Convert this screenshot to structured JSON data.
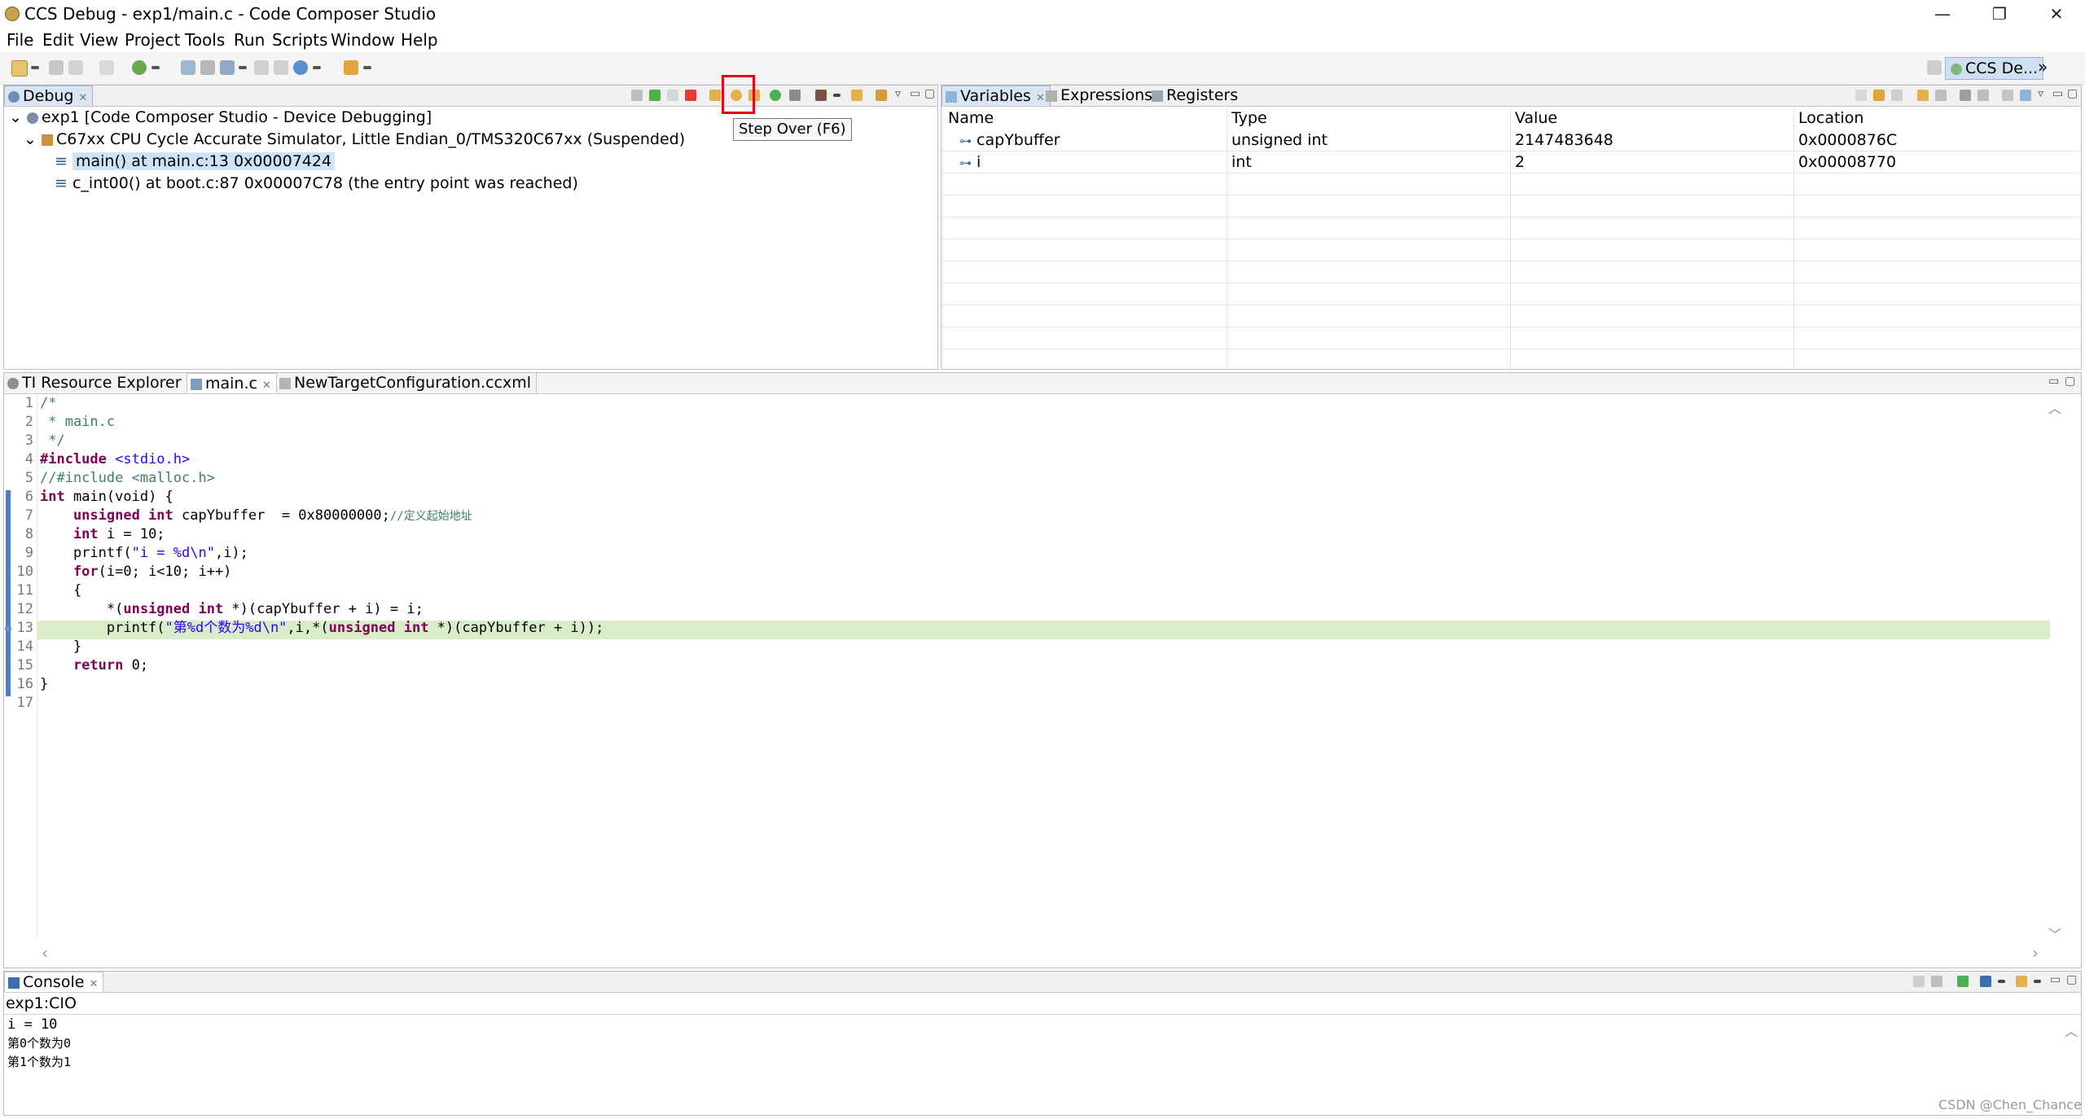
{
  "window": {
    "title": "CCS Debug - exp1/main.c - Code Composer Studio",
    "controls": {
      "minimize": "—",
      "maximize": "❐",
      "close": "✕"
    }
  },
  "menu": [
    "File",
    "Edit",
    "View",
    "Project",
    "Tools",
    "Run",
    "Scripts",
    "Window",
    "Help"
  ],
  "toolbar": {
    "perspective_label": "CCS De...",
    "overflow": "»"
  },
  "debug_view": {
    "tab_label": "Debug",
    "tree": [
      {
        "text": "exp1 [Code Composer Studio - Device Debugging]",
        "expander": "⌄"
      },
      {
        "text": "C67xx CPU Cycle Accurate Simulator, Little Endian_0/TMS320C67xx (Suspended)",
        "expander": "⌄"
      },
      {
        "text": "main() at main.c:13 0x00007424",
        "icon": "≡"
      },
      {
        "text": "c_int00() at boot.c:87 0x00007C78  (the entry point was reached)",
        "icon": "≡"
      }
    ],
    "tooltip": "Step Over (F6)"
  },
  "variables_view": {
    "tabs": [
      "Variables",
      "Expressions",
      "Registers"
    ],
    "columns": [
      "Name",
      "Type",
      "Value",
      "Location"
    ],
    "rows": [
      {
        "name": "capYbuffer",
        "type": "unsigned int",
        "value": "2147483648",
        "location": "0x0000876C"
      },
      {
        "name": "i",
        "type": "int",
        "value": "2",
        "location": "0x00008770"
      }
    ],
    "row_icon": "⊶"
  },
  "editor": {
    "tabs": [
      "TI Resource Explorer",
      "main.c",
      "NewTargetConfiguration.ccxml"
    ],
    "line_numbers": [
      "1",
      "2",
      "3",
      "4",
      "5",
      "6",
      "7",
      "8",
      "9",
      "10",
      "11",
      "12",
      "13",
      "14",
      "15",
      "16",
      "17"
    ],
    "lines": {
      "l1": "/*",
      "l2": " * main.c",
      "l3": " */",
      "l4_kw": "#include",
      "l4_rest": " <stdio.h>",
      "l5": "//#include <malloc.h>",
      "l6_kw": "int",
      "l6_rest": " main(void) {",
      "l7_kw": "    unsigned int",
      "l7_rest": " capYbuffer  = 0x80000000;",
      "l7_cm": "//定义起始地址",
      "l8_kw": "    int",
      "l8_rest": " i = 10;",
      "l9_a": "    printf(",
      "l9_str": "\"i = %d\\n\"",
      "l9_b": ",i);",
      "l10_kw": "    for",
      "l10_rest": "(i=0; i<10; i++)",
      "l11": "    {",
      "l12_a": "        *(",
      "l12_kw": "unsigned int",
      "l12_b": " *)(capYbuffer + i) = i;",
      "l13_a": "        printf(",
      "l13_str": "\"第%d个数为%d\\n\"",
      "l13_b": ",i,*(",
      "l13_kw": "unsigned int",
      "l13_c": " *)(capYbuffer + i));",
      "l14": "    }",
      "l15_kw": "    return",
      "l15_rest": " 0;",
      "l16": "}",
      "l17": ""
    },
    "hscroll_left": "‹",
    "hscroll_right": "›",
    "vscroll_up": "︿",
    "vscroll_down": "﹀"
  },
  "console": {
    "tab_label": "Console",
    "source": "exp1:CIO",
    "output": [
      "i = 10",
      "第0个数为0",
      "第1个数为1"
    ],
    "scroll_up": "︿"
  },
  "watermark": "CSDN @Chen_Chance",
  "colors": {
    "accent_selection": "#cde3f7",
    "current_line": "#d8edc8",
    "highlight_box": "#e2001a",
    "keyword": "#7f0055",
    "comment": "#3f7f5f",
    "string": "#2a00ff"
  }
}
